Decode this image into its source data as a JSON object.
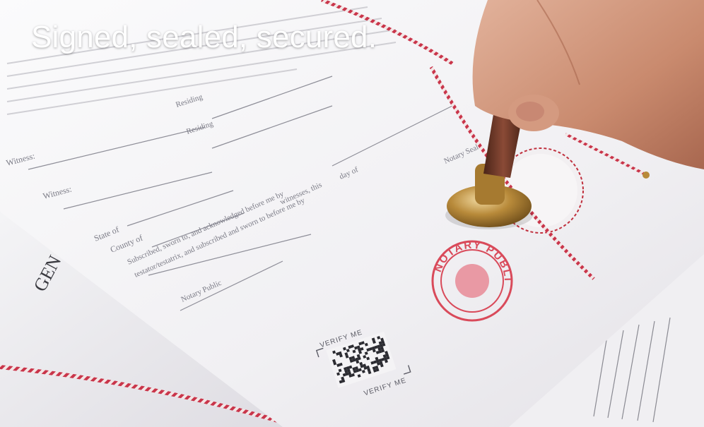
{
  "headline": "Signed, sealed, secured.",
  "document": {
    "witness_1": "Witness:",
    "witness_2": "Witness:",
    "residing_1": "Residing",
    "residing_2": "Residing",
    "state_of": "State of",
    "county_of": "County of",
    "subscribed_line_1": "Subscribed, sworn to, and acknowledged before me by",
    "subscribed_line_2": "testator/testatrix, and subscribed and sworn to before me by",
    "witnesses_this": "witnesses, this",
    "day_of": "day of",
    "notary_public": "Notary Public",
    "notary_seal": "Notary Seal",
    "verify_top": "VERIFY ME",
    "verify_bottom": "VERIFY ME",
    "seal_text": "NOTARY PUBLIC"
  },
  "back_document": {
    "heading_fragment": "GEN"
  },
  "colors": {
    "seal_red": "#d94a5a",
    "wax_red": "#c0303e",
    "twine_red": "#c9354a",
    "brass": "#b88a3a",
    "handle": "#6d3a2c",
    "skin": "#c98a6e"
  }
}
